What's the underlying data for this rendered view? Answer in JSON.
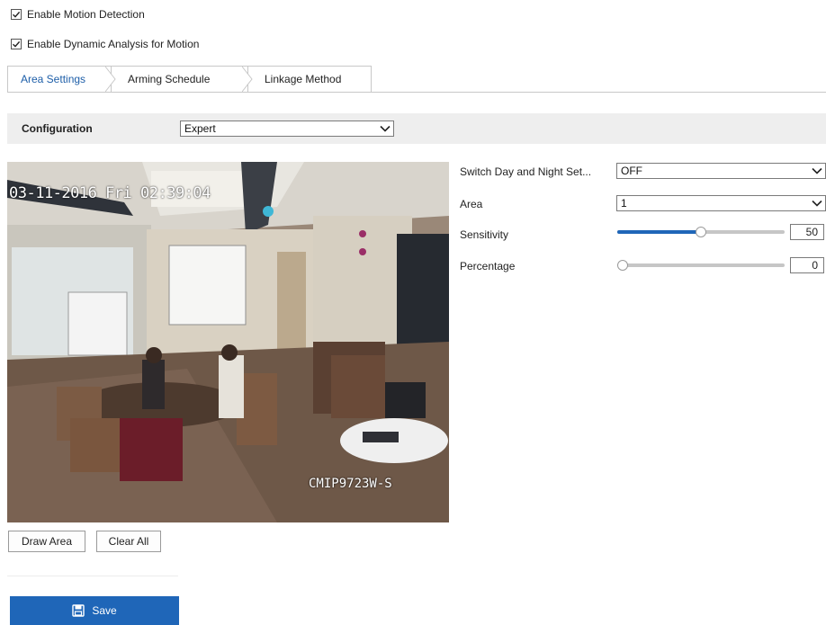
{
  "options": {
    "motion_detection": {
      "label": "Enable Motion Detection",
      "checked": true
    },
    "dynamic_analysis": {
      "label": "Enable Dynamic Analysis for Motion",
      "checked": true
    }
  },
  "tabs": [
    {
      "label": "Area Settings",
      "active": true
    },
    {
      "label": "Arming Schedule",
      "active": false
    },
    {
      "label": "Linkage Method",
      "active": false
    }
  ],
  "configuration": {
    "label": "Configuration",
    "value": "Expert"
  },
  "video": {
    "timestamp": "03-11-2016 Fri 02:39:04",
    "camera_name": "CMIP9723W-S"
  },
  "form": {
    "switch_day_night": {
      "label": "Switch Day and Night Set...",
      "value": "OFF"
    },
    "area": {
      "label": "Area",
      "value": "1"
    },
    "sensitivity": {
      "label": "Sensitivity",
      "value": "50",
      "fraction": 0.5
    },
    "percentage": {
      "label": "Percentage",
      "value": "0",
      "fraction": 0.0
    }
  },
  "buttons": {
    "draw_area": "Draw Area",
    "clear_all": "Clear All",
    "save": "Save"
  },
  "colors": {
    "accent": "#1f66b8",
    "bar_bg": "#eeeeee"
  },
  "icons": {
    "checkbox": "checkmark-icon",
    "dropdown": "chevron-down-icon",
    "save": "floppy-disk-icon"
  }
}
